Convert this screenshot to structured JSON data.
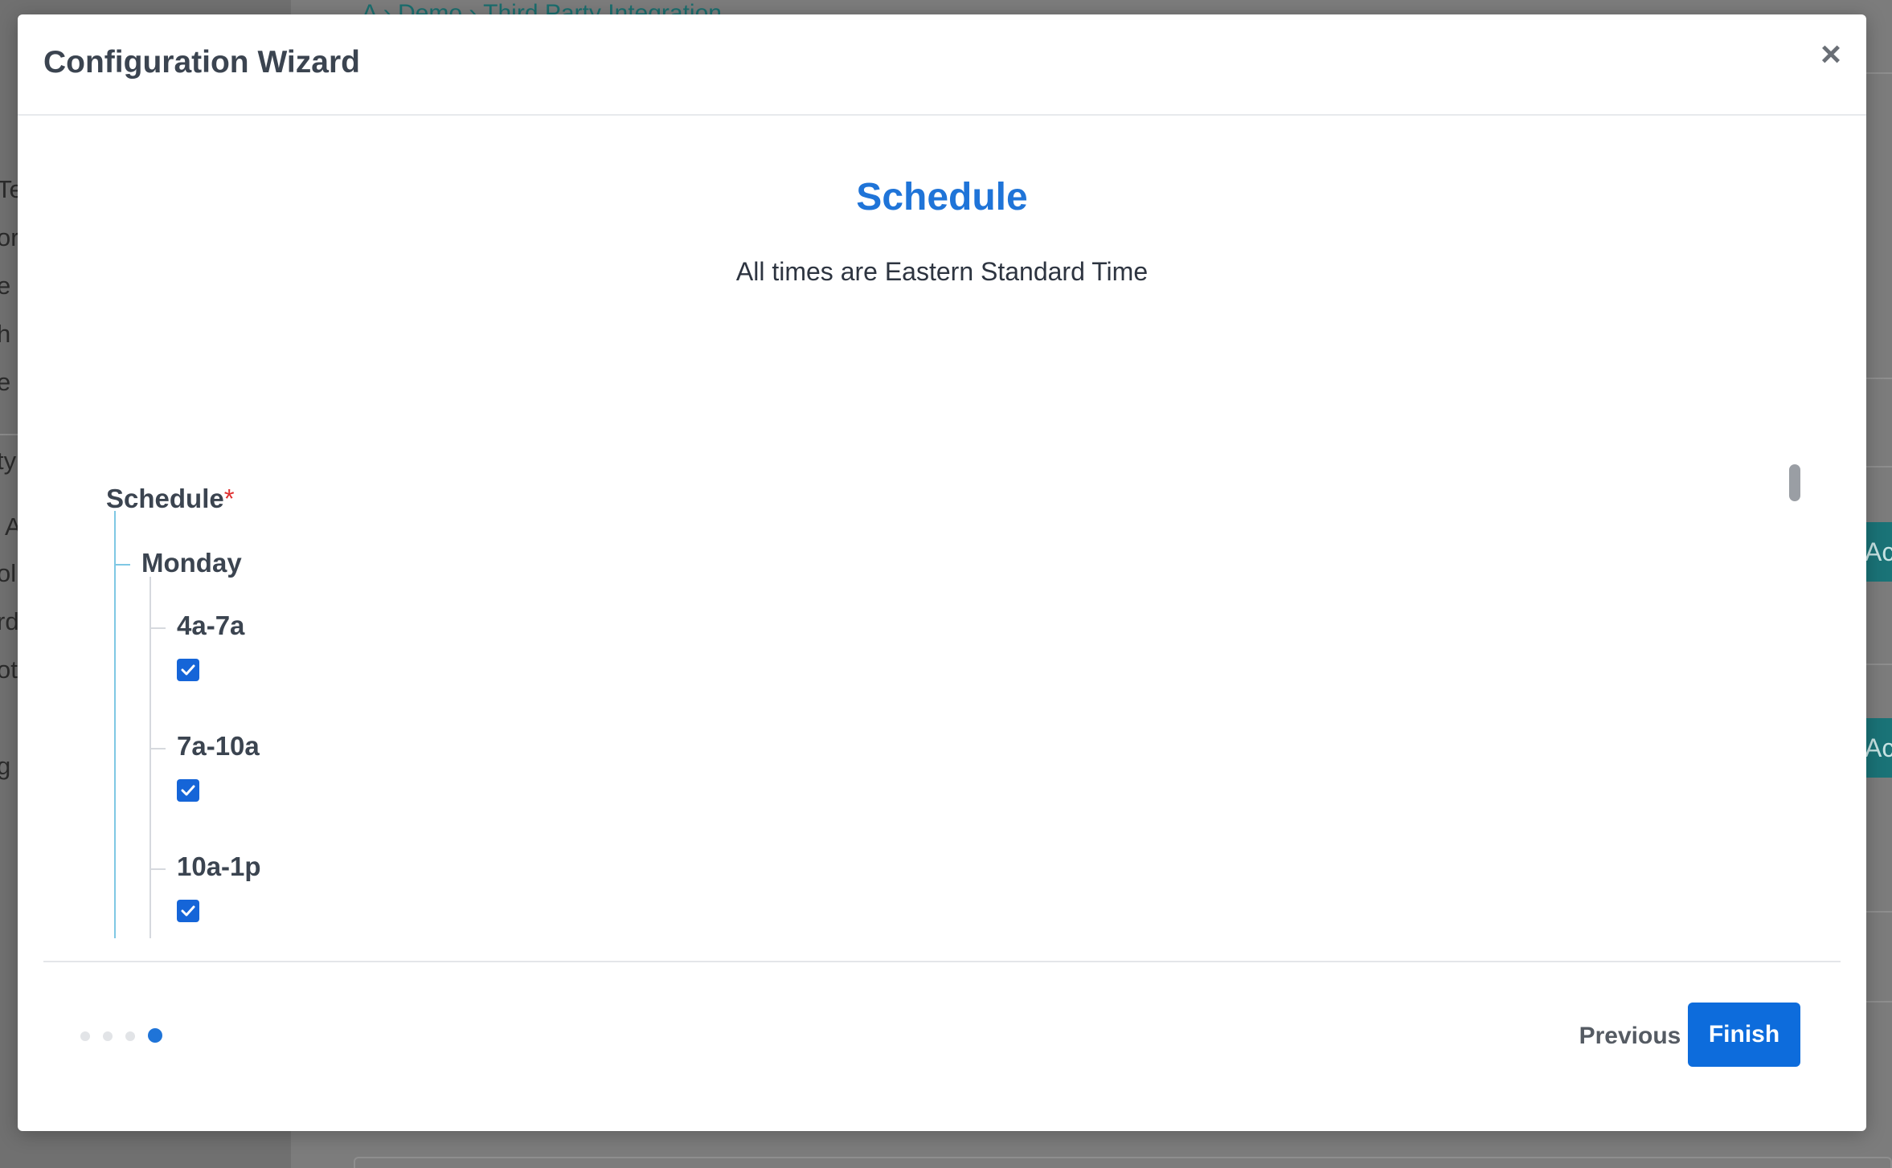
{
  "background": {
    "top_link": "A › Demo › Third Party Integration",
    "sidebar_fragments": [
      "Te",
      "or",
      "e I",
      "h",
      "e",
      "ty",
      "A",
      "ol",
      "rd",
      "ot",
      "g"
    ],
    "right_buttons": [
      "Ac",
      "Ac"
    ]
  },
  "modal": {
    "title": "Configuration Wizard",
    "close_symbol": "×"
  },
  "step": {
    "title": "Schedule",
    "subtitle": "All times are Eastern Standard Time"
  },
  "schedule": {
    "label": "Schedule",
    "required_mark": "*",
    "days": [
      {
        "name": "Monday",
        "slots": [
          {
            "label": "4a-7a",
            "checked": true
          },
          {
            "label": "7a-10a",
            "checked": true
          },
          {
            "label": "10a-1p",
            "checked": true
          }
        ]
      }
    ]
  },
  "pager": {
    "total_steps": 4,
    "current_step": 4
  },
  "footer": {
    "previous_label": "Previous",
    "finish_label": "Finish"
  },
  "colors": {
    "accent": "#1f74d8",
    "primary_button": "#0d6cdc",
    "required": "#e03131",
    "tree_line": "#7fc8e4"
  }
}
